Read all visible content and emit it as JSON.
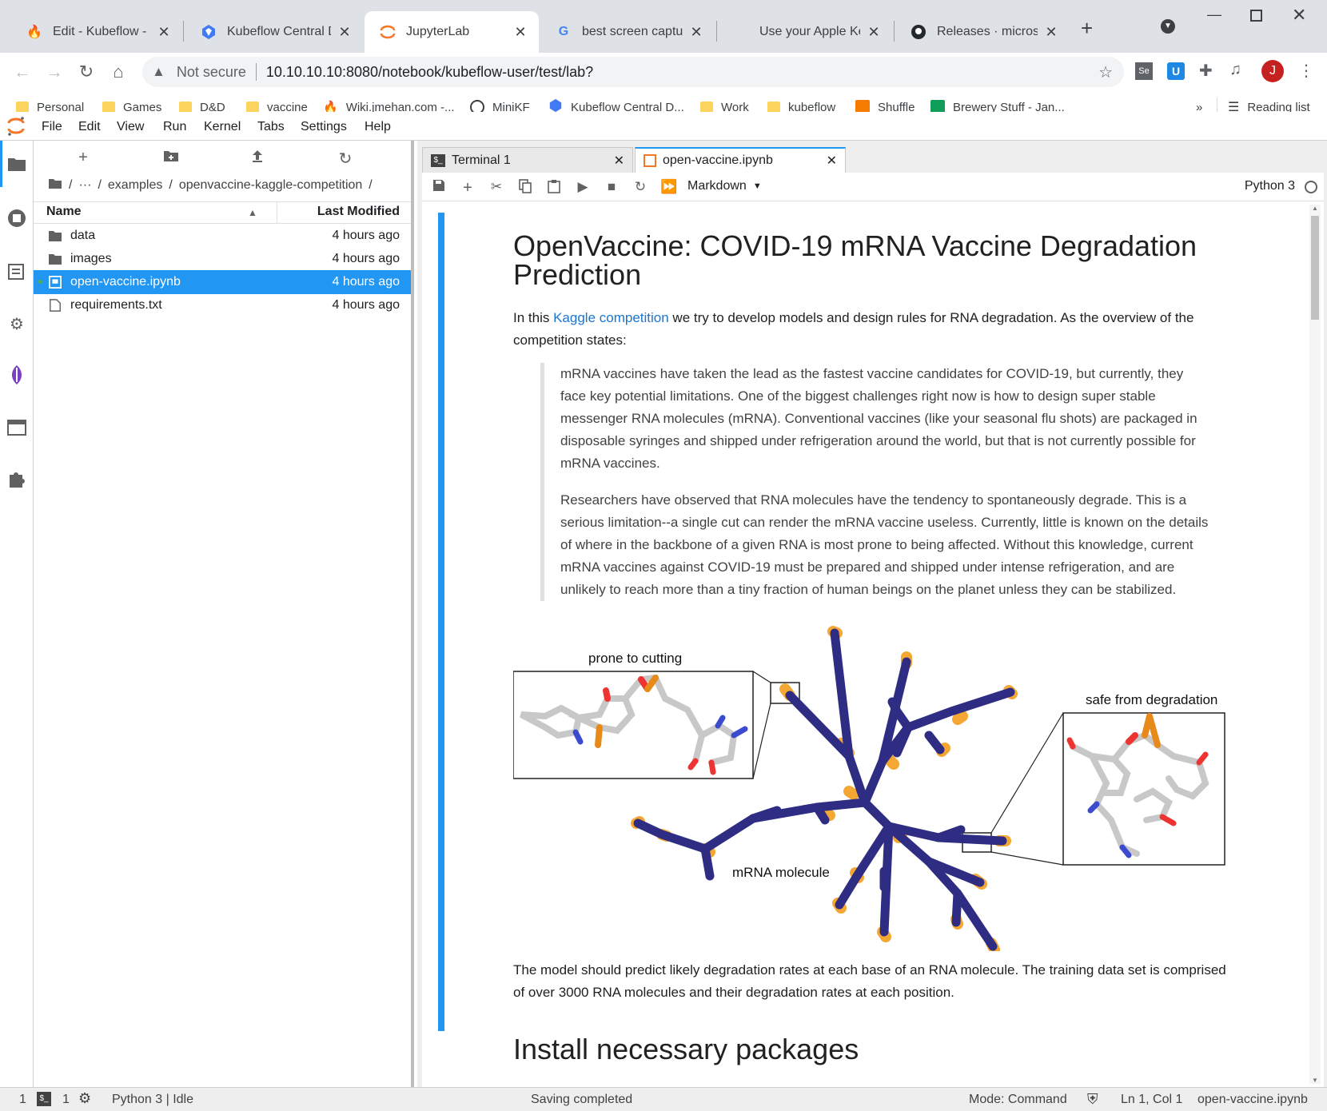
{
  "browser": {
    "tabs": [
      {
        "title": "Edit - Kubeflow - Get",
        "icon": "fire-icon",
        "active": false
      },
      {
        "title": "Kubeflow Central Das",
        "icon": "kubeflow-icon",
        "active": false
      },
      {
        "title": "JupyterLab",
        "icon": "jupyter-icon",
        "active": true
      },
      {
        "title": "best screen capture t",
        "icon": "google-icon",
        "active": false
      },
      {
        "title": "Use your Apple Keyb",
        "icon": "apple-icon",
        "active": false
      },
      {
        "title": "Releases · microsoft/",
        "icon": "github-icon",
        "active": false
      }
    ],
    "new_tab_icon": "plus-icon",
    "security_label": "Not secure",
    "url": "10.10.10.10:8080/notebook/kubeflow-user/test/lab?",
    "profile_initial": "J",
    "profile_color": "#c5221f",
    "bookmarks": [
      {
        "label": "Personal",
        "icon": "folder-icon"
      },
      {
        "label": "Games",
        "icon": "folder-icon"
      },
      {
        "label": "D&D",
        "icon": "folder-icon"
      },
      {
        "label": "vaccine",
        "icon": "folder-icon"
      },
      {
        "label": "Wiki.jmehan.com -...",
        "icon": "fire-icon"
      },
      {
        "label": "MiniKF",
        "icon": "minikf-icon"
      },
      {
        "label": "Kubeflow Central D...",
        "icon": "kubeflow-icon"
      },
      {
        "label": "Work",
        "icon": "folder-icon"
      },
      {
        "label": "kubeflow",
        "icon": "folder-icon"
      },
      {
        "label": "Shuffle",
        "icon": "shuffle-icon"
      },
      {
        "label": "Brewery Stuff - Jan...",
        "icon": "sheets-icon"
      }
    ],
    "more_bookmarks": "»",
    "reading_list": "Reading list"
  },
  "jupyter": {
    "menu": [
      "File",
      "Edit",
      "View",
      "Run",
      "Kernel",
      "Tabs",
      "Settings",
      "Help"
    ],
    "breadcrumb": [
      "examples",
      "openvaccine-kaggle-competition"
    ],
    "breadcrumb_ellipsis": "···",
    "file_header": {
      "name": "Name",
      "modified": "Last Modified"
    },
    "files": [
      {
        "name": "data",
        "type": "folder",
        "modified": "4 hours ago",
        "selected": false
      },
      {
        "name": "images",
        "type": "folder",
        "modified": "4 hours ago",
        "selected": false
      },
      {
        "name": "open-vaccine.ipynb",
        "type": "notebook",
        "modified": "4 hours ago",
        "selected": true
      },
      {
        "name": "requirements.txt",
        "type": "file",
        "modified": "4 hours ago",
        "selected": false
      }
    ],
    "doc_tabs": [
      {
        "label": "Terminal 1",
        "active": false
      },
      {
        "label": "open-vaccine.ipynb",
        "active": true
      }
    ],
    "cell_type": "Markdown",
    "kernel_name": "Python 3",
    "notebook": {
      "title": "OpenVaccine: COVID-19 mRNA Vaccine Degradation Prediction",
      "intro_before_link": "In this",
      "intro_link": "Kaggle competition",
      "intro_after_link": "we try to develop models and design rules for RNA degradation. As the overview of the competition states:",
      "quote1": "mRNA vaccines have taken the lead as the fastest vaccine candidates for COVID-19, but currently, they face key potential limitations. One of the biggest challenges right now is how to design super stable messenger RNA molecules (mRNA). Conventional vaccines (like your seasonal flu shots) are packaged in disposable syringes and shipped under refrigeration around the world, but that is not currently possible for mRNA vaccines.",
      "quote2": "Researchers have observed that RNA molecules have the tendency to spontaneously degrade. This is a serious limitation--a single cut can render the mRNA vaccine useless. Currently, little is known on the details of where in the backbone of a given RNA is most prone to being affected. Without this knowledge, current mRNA vaccines against COVID-19 must be prepared and shipped under intense refrigeration, and are unlikely to reach more than a tiny fraction of human beings on the planet unless they can be stabilized.",
      "figure": {
        "label_cutting": "prone to cutting",
        "label_safe": "safe from degradation",
        "label_molecule": "mRNA molecule",
        "backbone_color": "#2e2d83",
        "exposed_color": "#f5a733"
      },
      "para2": "The model should predict likely degradation rates at each base of an RNA molecule. The training data set is comprised of over 3000 RNA molecules and their degradation rates at each position.",
      "heading2": "Install necessary packages"
    }
  },
  "status": {
    "terminals": "1",
    "kernels": "1",
    "kernel_status": "Python 3 | Idle",
    "save_status": "Saving completed",
    "mode": "Mode: Command",
    "cursor": "Ln 1, Col 1",
    "file": "open-vaccine.ipynb"
  },
  "colors": {
    "accent": "#2196f3",
    "jupyter_orange": "#f37726",
    "link": "#1976d2"
  }
}
